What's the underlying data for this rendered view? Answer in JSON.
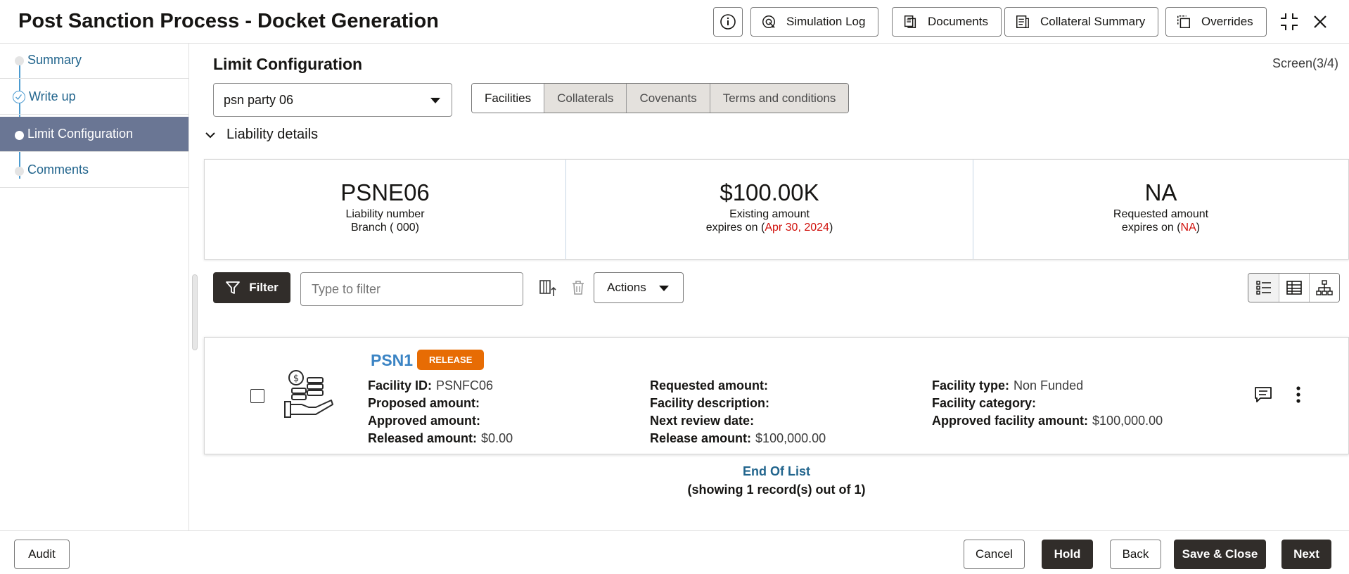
{
  "header": {
    "title": "Post Sanction Process - Docket Generation",
    "buttons": {
      "simulation_log": "Simulation Log",
      "documents": "Documents",
      "collateral_summary": "Collateral Summary",
      "overrides": "Overrides"
    }
  },
  "sidebar": {
    "items": [
      {
        "label": "Summary",
        "state": "pending"
      },
      {
        "label": "Write up",
        "state": "completed"
      },
      {
        "label": "Limit Configuration",
        "state": "active"
      },
      {
        "label": "Comments",
        "state": "pending"
      }
    ]
  },
  "main": {
    "title": "Limit Configuration",
    "screen_count": "Screen(3/4)",
    "party_select_value": "psn party 06",
    "tabs": [
      "Facilities",
      "Collaterals",
      "Covenants",
      "Terms and conditions"
    ],
    "selected_tab": "Facilities",
    "liability_section_label": "Liability details",
    "liability_cards": {
      "number": {
        "big": "PSNE06",
        "line1": "Liability number",
        "line2": "Branch ( 000)"
      },
      "existing": {
        "big": "$100.00K",
        "line1": "Existing amount",
        "line2_prefix": "expires on (",
        "line2_value": "Apr 30, 2024",
        "line2_suffix": ")"
      },
      "requested": {
        "big": "NA",
        "line1": "Requested amount",
        "line2_prefix": "expires on (",
        "line2_value": "NA",
        "line2_suffix": ")"
      }
    },
    "toolbar": {
      "filter_label": "Filter",
      "filter_placeholder": "Type to filter",
      "actions_label": "Actions"
    },
    "facility": {
      "name": "PSN1",
      "badge": "RELEASE",
      "col1": [
        {
          "label": "Facility ID:",
          "value": "PSNFC06"
        },
        {
          "label": "Proposed amount:",
          "value": ""
        },
        {
          "label": "Approved amount:",
          "value": ""
        },
        {
          "label": "Released amount:",
          "value": "$0.00"
        }
      ],
      "col2": [
        {
          "label": "Requested amount:",
          "value": ""
        },
        {
          "label": "Facility description:",
          "value": ""
        },
        {
          "label": "Next review date:",
          "value": ""
        },
        {
          "label": "Release amount:",
          "value": "$100,000.00"
        }
      ],
      "col3": [
        {
          "label": "Facility type:",
          "value": "Non Funded"
        },
        {
          "label": "Facility category:",
          "value": ""
        },
        {
          "label": "Approved facility amount:",
          "value": "$100,000.00"
        }
      ]
    },
    "end_of_list": "End Of List",
    "record_summary": "(showing 1 record(s) out of 1)"
  },
  "footer": {
    "audit": "Audit",
    "cancel": "Cancel",
    "hold": "Hold",
    "back": "Back",
    "save_close": "Save & Close",
    "next": "Next"
  },
  "colors": {
    "active_sidebar": "#6a7694",
    "link_blue": "#22658d",
    "badge_orange": "#e76c04",
    "dark_button": "#312d2a",
    "expiry_red": "#d0110c"
  }
}
